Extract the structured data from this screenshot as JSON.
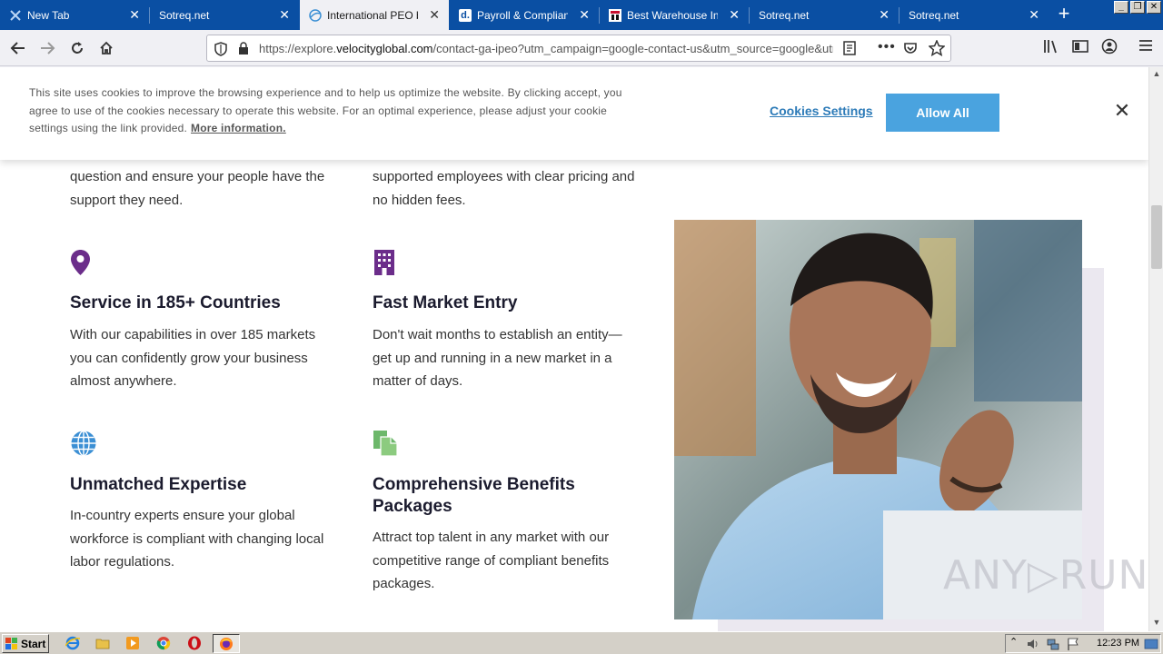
{
  "tabs": [
    {
      "label": "New Tab",
      "icon": "x-logo-icon"
    },
    {
      "label": "Sotreq.net",
      "icon": ""
    },
    {
      "label": "International PEO by V",
      "icon": "velocity-globe-icon",
      "active": true
    },
    {
      "label": "Payroll & Compliance",
      "icon": "d-logo-icon"
    },
    {
      "label": "Best Warehouse Inve",
      "icon": "warehouse-logo-icon"
    },
    {
      "label": "Sotreq.net",
      "icon": ""
    },
    {
      "label": "Sotreq.net",
      "icon": ""
    }
  ],
  "address_bar": {
    "url_prefix": "https://explore.",
    "url_domain": "velocityglobal.com",
    "url_suffix": "/contact-ga-ipeo?utm_campaign=google-contact-us&utm_source=google&utm"
  },
  "cookie_banner": {
    "text": "This site uses cookies to improve the browsing experience and to help us optimize the website. By clicking accept, you agree to use of the cookies necessary to operate this website. For an optimal experience, please adjust your cookie settings using the link provided.",
    "more_info": "More information.",
    "settings_label": "Cookies Settings",
    "allow_label": "Allow All",
    "close": "✕"
  },
  "features": {
    "partial_left": "question and ensure your people have the support they need.",
    "partial_right": "supported employees with clear pricing and no hidden fees.",
    "items": [
      {
        "title": "Service in 185+ Countries",
        "text": "With our capabilities in over 185 markets you can confidently grow your business almost anywhere."
      },
      {
        "title": "Fast Market Entry",
        "text": "Don't wait months to establish an entity—get up and running in a new market in a matter of days."
      },
      {
        "title": "Unmatched Expertise",
        "text": "In-country experts ensure your global workforce is compliant with changing local labor regulations."
      },
      {
        "title": "Comprehensive Benefits Packages",
        "text": "Attract top talent in any market with our competitive range of compliant benefits packages."
      }
    ]
  },
  "watermark": "ANY▷RUN",
  "taskbar": {
    "start": "Start",
    "clock": "12:23 PM"
  },
  "colors": {
    "tabstrip": "#0a4fa3",
    "allow_button": "#4aa3df",
    "icon_purple": "#6b2d8a",
    "icon_blue": "#3b8fd4",
    "icon_green": "#6db86b"
  }
}
